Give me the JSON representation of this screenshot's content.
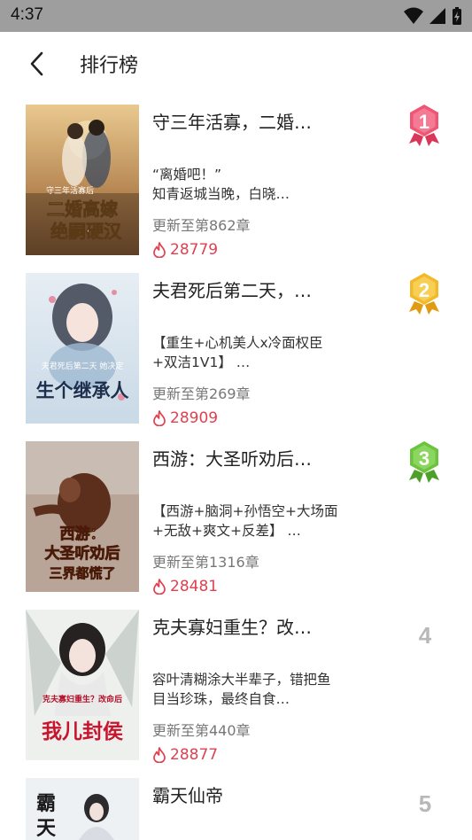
{
  "status_bar": {
    "time": "4:37"
  },
  "header": {
    "title": "排行榜"
  },
  "colors": {
    "heat": "#e0404f",
    "gold": "#f2b92b",
    "pink": "#ef5674",
    "green": "#6cc33f"
  },
  "items": [
    {
      "title": "守三年活寡，二婚…",
      "desc": "“离婚吧！”\n知青返城当晚，白晓…",
      "update": "更新至第862章",
      "heat": "28779",
      "rank": "1",
      "cover_text": "二婚高嫁\n绝嗣硬汉",
      "cover_sub": "守三年活寡后"
    },
    {
      "title": "夫君死后第二天，…",
      "desc": "【重生+心机美人x冷面权臣+双洁1V1】 …",
      "update": "更新至第269章",
      "heat": "28909",
      "rank": "2",
      "cover_text": "生个继承人",
      "cover_sub": "夫君死后第二天 她决定"
    },
    {
      "title": "西游：大圣听劝后…",
      "desc": "【西游+脑洞+孙悟空+大场面+无敌+爽文+反差】 …",
      "update": "更新至第1316章",
      "heat": "28481",
      "rank": "3",
      "cover_text": "西游：大圣听劝后\n三界都慌了",
      "cover_sub": ""
    },
    {
      "title": "克夫寡妇重生？改…",
      "desc": "容叶清糊涂大半辈子，错把鱼目当珍珠，最终自食…",
      "update": "更新至第440章",
      "heat": "28877",
      "rank": "4",
      "cover_text": "我儿封侯",
      "cover_sub": "克夫寡妇重生？改命后"
    },
    {
      "title": "霸天仙帝",
      "desc": "",
      "update": "",
      "heat": "",
      "rank": "5",
      "cover_text": "霸天",
      "cover_sub": ""
    }
  ]
}
